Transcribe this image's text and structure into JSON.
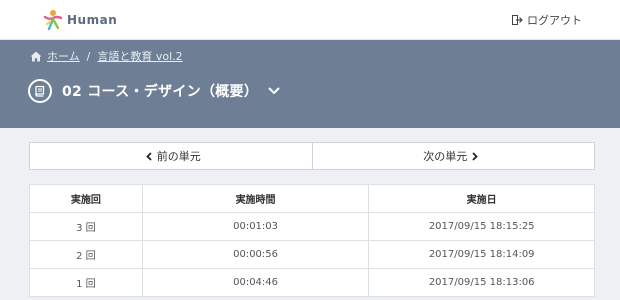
{
  "header": {
    "logo_text": "Human",
    "logout_label": "ログアウト"
  },
  "breadcrumb": {
    "home_label": "ホーム",
    "course_label": "言語と教育 vol.2"
  },
  "page": {
    "title": "02 コース・デザイン（概要）"
  },
  "unit_nav": {
    "prev_label": "前の単元",
    "next_label": "次の単元"
  },
  "attempts_table": {
    "headers": [
      "実施回",
      "実施時間",
      "実施日"
    ],
    "rows": [
      [
        "3 回",
        "00:01:03",
        "2017/09/15 18:15:25"
      ],
      [
        "2 回",
        "00:00:56",
        "2017/09/15 18:14:09"
      ],
      [
        "1 回",
        "00:04:46",
        "2017/09/15 18:13:06"
      ]
    ]
  },
  "colors": {
    "hero_bg": "#6e7f95",
    "page_bg": "#eef0f3"
  }
}
